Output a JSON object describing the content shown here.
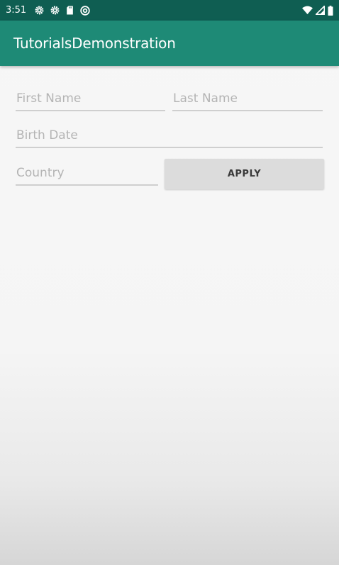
{
  "status_bar": {
    "time": "3:51",
    "left_icons": [
      "gear-icon",
      "gear-icon",
      "sd-card-icon",
      "at-sign-icon"
    ],
    "right_icons": [
      "wifi-icon",
      "signal-icon",
      "battery-icon"
    ]
  },
  "app_bar": {
    "title": "TutorialsDemonstration"
  },
  "form": {
    "first_name_placeholder": "First Name",
    "last_name_placeholder": "Last Name",
    "birth_date_placeholder": "Birth Date",
    "country_placeholder": "Country",
    "apply_label": "APPLY"
  },
  "colors": {
    "status_bar": "#0f5e52",
    "app_bar": "#1e8a76",
    "button": "#dcdcdc",
    "underline": "#cfcfcf"
  }
}
